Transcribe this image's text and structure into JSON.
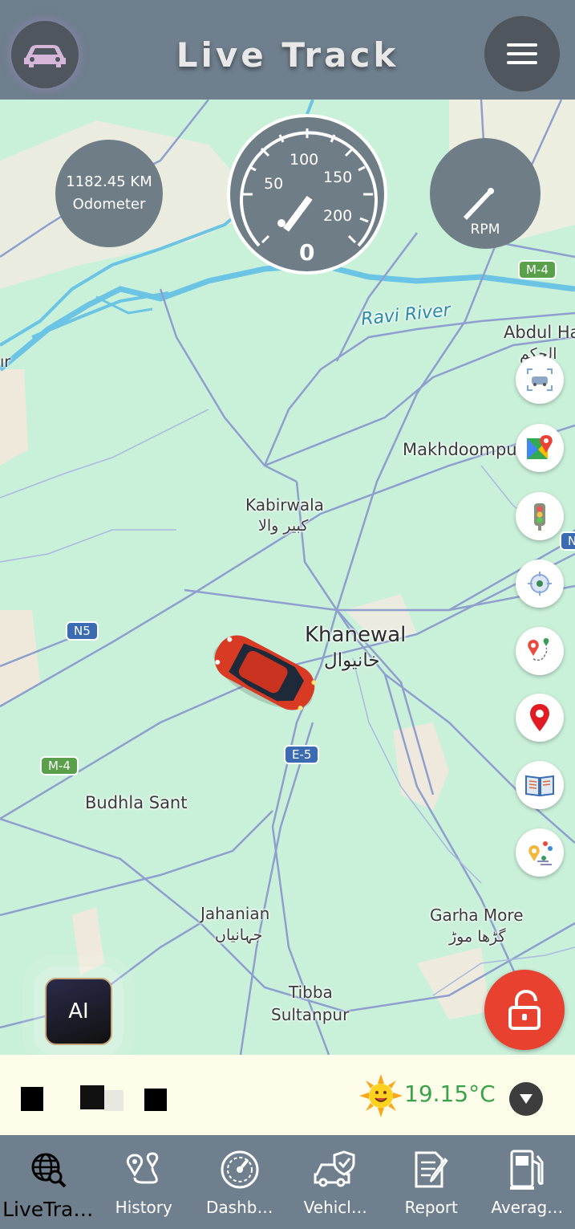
{
  "header": {
    "title": "Live Track"
  },
  "gauges": {
    "odometer_value": "1182.45 KM",
    "odometer_label": "Odometer",
    "speed_value": "0",
    "speed_ticks": [
      "50",
      "100",
      "150",
      "200"
    ],
    "rpm_label": "RPM"
  },
  "map": {
    "labels": {
      "ravi_river": "Ravi River",
      "abdul_hakim": "Abdul Ha",
      "abdul_hakim_urdu": "الحکم",
      "makhdoompur": "Makhdoompu",
      "kabirwala": "Kabirwala",
      "kabirwala_urdu": "کبیر والا",
      "khanewal": "Khanewal",
      "khanewal_urdu": "خانیوال",
      "budhla_sant": "Budhla Sant",
      "jahanian": "Jahanian",
      "jahanian_urdu": "جہانیاں",
      "garha_more": "Garha More",
      "garha_more_urdu": "گڑھا موڑ",
      "tibba": "Tibba",
      "sultanpur": "Sultanpur",
      "left_edge": "ır"
    },
    "shields": {
      "m4_top": "M-4",
      "m4_left": "M-4",
      "n5": "N5",
      "e5": "E-5",
      "n_right": "N"
    }
  },
  "side_buttons": [
    "vehicle-scan-icon",
    "google-maps-icon",
    "traffic-light-icon",
    "locate-icon",
    "route-icon",
    "location-pin-icon",
    "book-icon",
    "multi-location-icon"
  ],
  "ai_button": {
    "label": "AI"
  },
  "status_bar": {
    "temperature": "19.15°C",
    "weather_icon": "sun-icon"
  },
  "bottom_nav": [
    {
      "label": "LiveTra…",
      "icon": "globe-search-icon"
    },
    {
      "label": "History",
      "icon": "history-route-icon"
    },
    {
      "label": "Dashb…",
      "icon": "speedometer-icon"
    },
    {
      "label": "Vehicl…",
      "icon": "vehicle-shield-icon"
    },
    {
      "label": "Report",
      "icon": "report-icon"
    },
    {
      "label": "Averag…",
      "icon": "fuel-pump-icon"
    }
  ],
  "colors": {
    "header": "#6f7f8d",
    "map_green": "#c9f0d9",
    "road": "#8e9fce",
    "river": "#6cc4e4",
    "lock": "#e8412f",
    "temp": "#3aa24a"
  }
}
